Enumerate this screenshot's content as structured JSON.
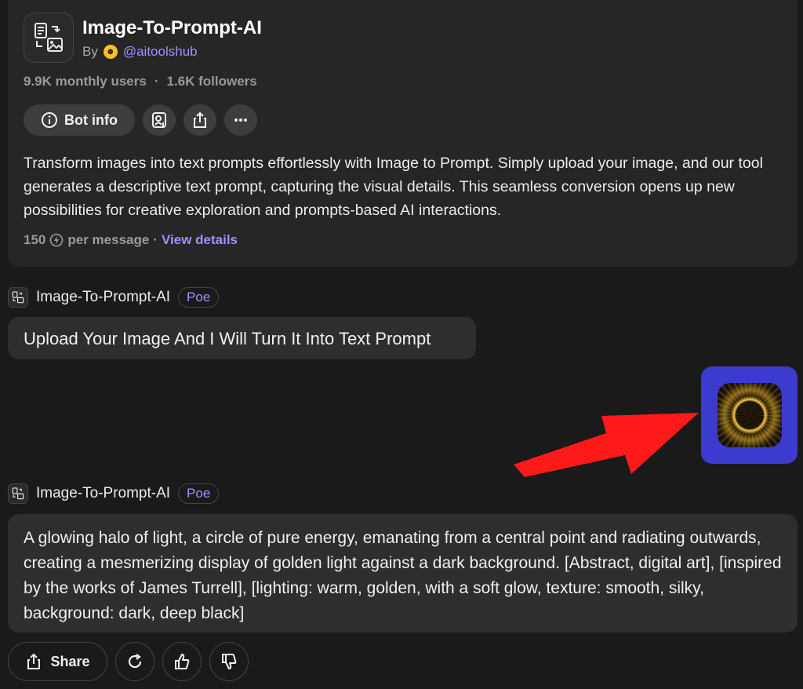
{
  "bot": {
    "name": "Image-To-Prompt-AI",
    "by_label": "By",
    "creator_handle": "@aitoolshub",
    "monthly_users": "9.9K monthly users",
    "separator": "·",
    "followers": "1.6K followers",
    "bot_info_label": "Bot info",
    "description": "Transform images into text prompts effortlessly with Image to Prompt. Simply upload your image, and our tool generates a descriptive text prompt, capturing the visual details. This seamless conversion opens up new possibilities for creative exploration and prompts-based AI interactions.",
    "cost_value": "150",
    "cost_suffix": "per message",
    "cost_separator": "·",
    "view_details_label": "View details"
  },
  "messages": [
    {
      "sender": "Image-To-Prompt-AI",
      "tag": "Poe",
      "text": "Upload Your Image And I Will Turn It Into Text Prompt"
    },
    {
      "sender": "Image-To-Prompt-AI",
      "tag": "Poe",
      "text": "A glowing halo of light, a circle of pure energy, emanating from a central point and radiating outwards, creating a mesmerizing display of golden light against a dark background. [Abstract, digital art], [inspired by the works of James Turrell], [lighting: warm, golden, with a soft glow, texture: smooth, silky, background: dark, deep black]"
    }
  ],
  "actions": {
    "share_label": "Share"
  },
  "icons": {
    "bot_avatar": "image-to-text-icon",
    "info": "info-icon",
    "add_person": "person-add-icon",
    "share": "share-icon",
    "more": "more-icon",
    "bolt": "compute-point-icon",
    "retry": "retry-icon",
    "like": "thumbs-up-icon",
    "dislike": "thumbs-down-icon"
  },
  "colors": {
    "background": "#1a1a1a",
    "card": "#262626",
    "accent": "#9c93ff",
    "user_image_frame": "#3b3bd0",
    "annotation_arrow": "#ff1a1a"
  }
}
